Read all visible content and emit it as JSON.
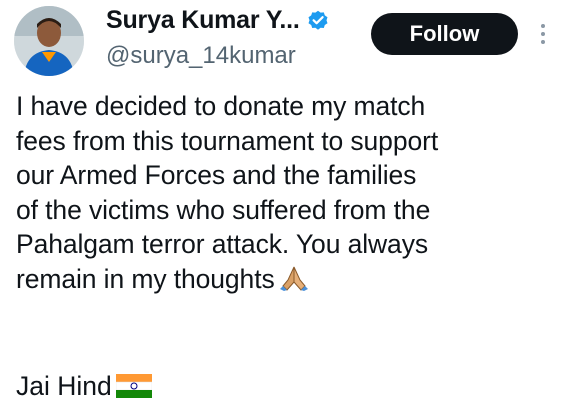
{
  "author": {
    "display_name": "Surya Kumar Y...",
    "handle": "@surya_14kumar",
    "verified_icon": "verified-badge-icon",
    "avatar_icon": "profile-avatar"
  },
  "actions": {
    "follow_label": "Follow",
    "more_icon": "more-options-icon"
  },
  "tweet": {
    "lines": [
      "I have decided to donate my match",
      "fees from this tournament to support",
      "our Armed Forces and the families",
      "of the victims who suffered from the",
      "Pahalgam terror attack. You always",
      "remain in my thoughts"
    ],
    "prayer_emoji": "folded-hands-emoji",
    "closing": "Jai Hind",
    "flag_emoji": "india-flag-emoji"
  },
  "colors": {
    "text": "#0f1419",
    "secondary_text": "#536471",
    "verified_blue": "#1d9bf0",
    "follow_bg": "#0f1419"
  }
}
